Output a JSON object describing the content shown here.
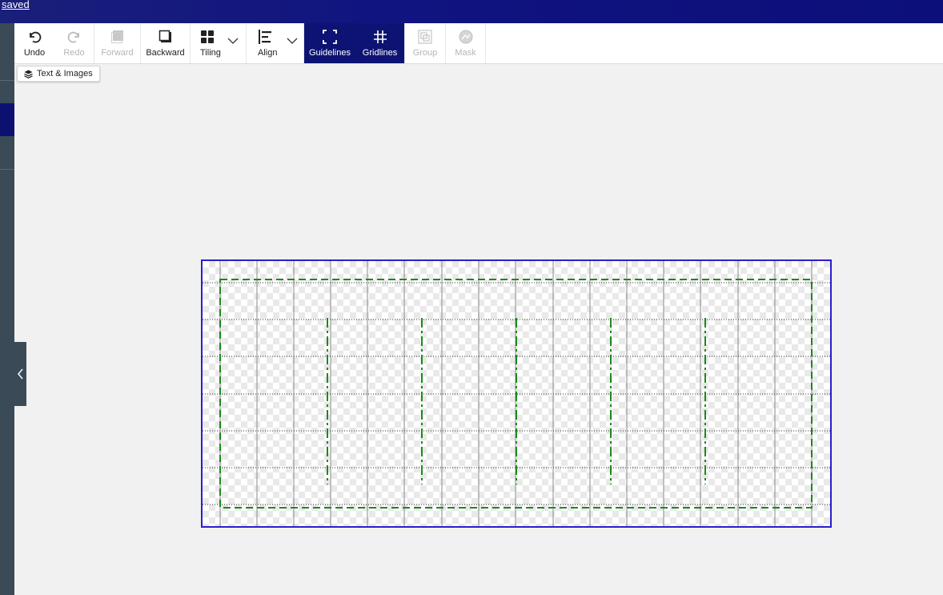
{
  "header": {
    "saved_label": "saved"
  },
  "toolbar": {
    "undo": "Undo",
    "redo": "Redo",
    "forward": "Forward",
    "backward": "Backward",
    "tiling": "Tiling",
    "align": "Align",
    "guidelines": "Guidelines",
    "gridlines": "Gridlines",
    "group": "Group",
    "mask": "Mask"
  },
  "layers": {
    "label": "Text & Images"
  },
  "colors": {
    "header_bg": "#101480",
    "active_tool_bg": "#0d1373",
    "canvas_border": "#2a1fd0",
    "guideline": "#1a8a1a",
    "rail_bg": "#3b4a57"
  },
  "icons": {
    "undo": "undo-icon",
    "redo": "redo-icon",
    "forward": "bring-forward-icon",
    "backward": "send-backward-icon",
    "tiling": "tiling-grid-icon",
    "align": "align-left-icon",
    "guidelines": "guidelines-frame-icon",
    "gridlines": "grid-hash-icon",
    "group": "group-icon",
    "mask": "mask-icon",
    "layers": "layers-icon",
    "collapse": "chevron-left-icon"
  }
}
